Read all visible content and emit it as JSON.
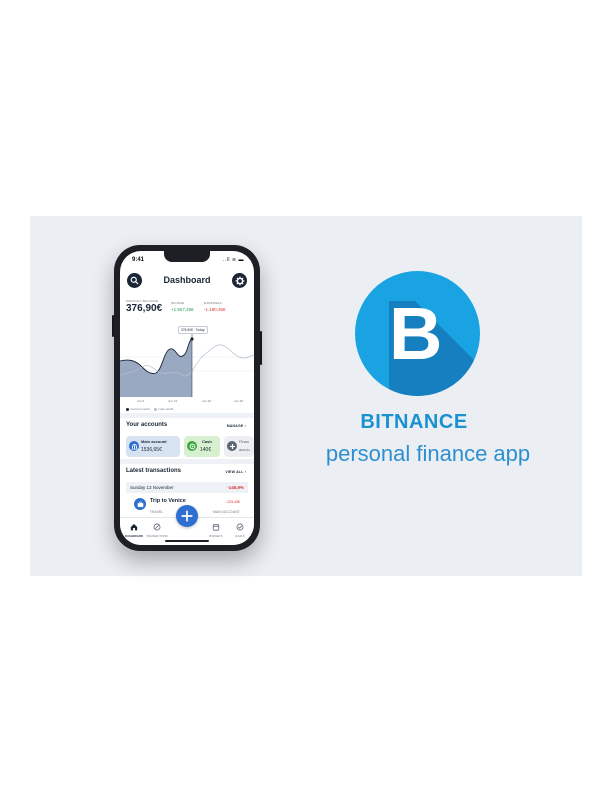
{
  "phone": {
    "status": {
      "time": "9:41",
      "icons": "..ll ≋ ▬"
    },
    "header": {
      "title": "Dashboard"
    },
    "stats": {
      "balance_label": "MONTHLY BALANCE",
      "balance_value": "376,90€",
      "income_label": "INCOME",
      "income_value": "+1.557,25€",
      "expenses_label": "EXPENSES",
      "expenses_value": "-1.180,35€"
    },
    "chart": {
      "tooltip": "376,90€ · Today",
      "x_ticks": [
        "nov 6",
        "nov 13",
        "nov 20",
        "nov 26"
      ],
      "legend": [
        "Current month",
        "Last month"
      ]
    },
    "accounts": {
      "title": "Your accounts",
      "manage": "MANAGE ›",
      "items": [
        {
          "name": "Main account",
          "value": "1536,65€"
        },
        {
          "name": "Cash",
          "value": "140€"
        },
        {
          "name": "Finan",
          "value": "accou"
        }
      ]
    },
    "transactions": {
      "title": "Latest transactions",
      "view_all": "VIEW ALL ›",
      "day_label": "Sunday 13 November",
      "day_total": "-146,9%",
      "item": {
        "name": "Trip to Venice",
        "category": "TRAVEL",
        "amount": "-225,45€",
        "account": "MAIN ACCOUNT"
      }
    },
    "tabs": [
      "DASHBOARD",
      "TRANSACTIONS",
      "",
      "BUDGETS",
      "GOALS"
    ]
  },
  "brand": {
    "name": "BITNANCE",
    "tagline": "personal finance app",
    "logo_letter": "B",
    "colors": {
      "primary": "#1aa3e3",
      "shadow": "#1378b8",
      "text": "#1a91d1"
    }
  },
  "icons": [
    "search-icon",
    "gear-icon",
    "bank-icon",
    "cash-icon",
    "plus-icon",
    "travel-icon",
    "home-icon",
    "transactions-icon",
    "budgets-icon",
    "goals-icon"
  ]
}
